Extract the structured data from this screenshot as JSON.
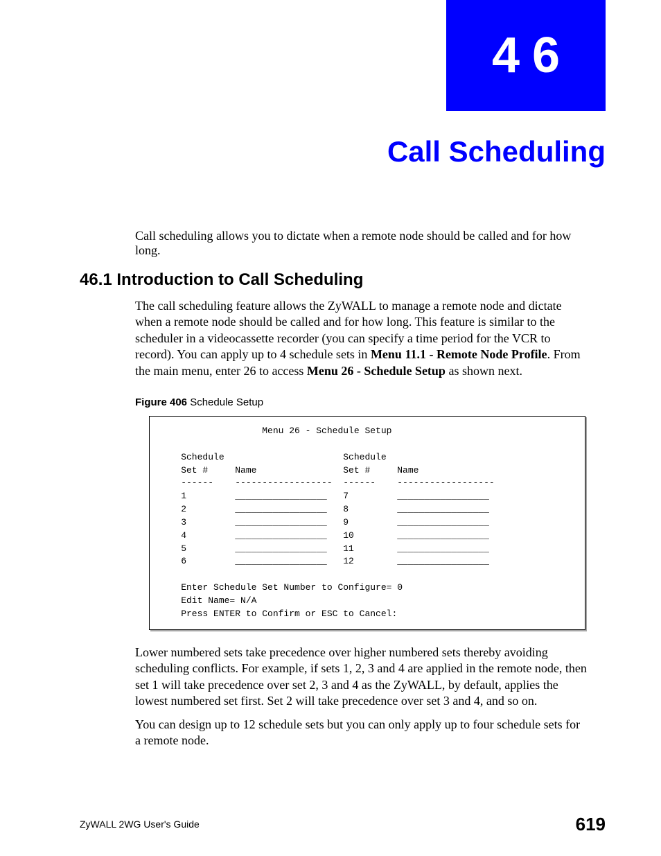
{
  "chapter_number": "46",
  "chapter_title": "Call Scheduling",
  "intro_text": "Call scheduling allows you to dictate when a remote node should be called and for how long.",
  "section_heading": "46.1  Introduction to Call Scheduling",
  "section_body_pre": "The call scheduling feature allows the ZyWALL to manage a remote node and dictate when a remote node should be called and for how long. This feature is similar to the scheduler in a videocassette recorder (you can specify a time period for the VCR to record). You can apply up to 4 schedule sets in ",
  "menu11_bold": "Menu 11.1 - Remote Node Profile",
  "section_body_mid": ". From the main menu, enter 26 to access ",
  "menu26_bold": "Menu 26 - Schedule Setup",
  "section_body_post": " as shown next.",
  "figure_caption_bold": "Figure 406",
  "figure_caption_rest": "   Schedule Setup",
  "terminal": "                   Menu 26 - Schedule Setup\n\n    Schedule                      Schedule\n    Set #     Name                Set #     Name\n    ------    ------------------  ------    ------------------\n    1         _________________   7         _________________\n    2         _________________   8         _________________\n    3         _________________   9         _________________\n    4         _________________   10        _________________\n    5         _________________   11        _________________\n    6         _________________   12        _________________\n\n    Enter Schedule Set Number to Configure= 0\n    Edit Name= N/A\n    Press ENTER to Confirm or ESC to Cancel:",
  "post_para1": "Lower numbered sets take precedence over higher numbered sets thereby avoiding scheduling conflicts. For example, if sets 1, 2, 3 and 4 are applied in the remote node, then set 1 will take precedence over set 2, 3 and 4 as the ZyWALL, by default, applies the lowest numbered set first. Set 2 will take precedence over set 3 and 4, and so on.",
  "post_para2": "You can design up to 12 schedule sets but you can only apply up to four schedule sets for a remote node.",
  "footer_left": "ZyWALL 2WG User's Guide",
  "footer_right": "619"
}
